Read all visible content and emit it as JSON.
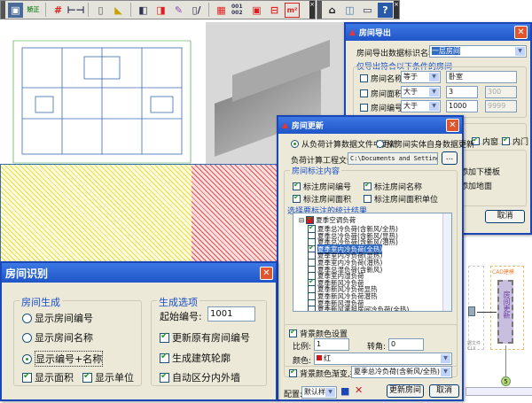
{
  "toolbar1": {
    "icons": [
      "room-recognize-icon",
      "correct-icon",
      "grid-icon",
      "dimension-icon",
      "wall-icon",
      "arc-area-icon",
      "door-icon",
      "door-dropdown-icon",
      "edit-icon",
      "window-edit-icon",
      "table-search-icon",
      "number-sort-icon",
      "room-frame-icon",
      "export-icon",
      "area-m2-icon"
    ],
    "correct_label": "矫正",
    "area_label": "m²",
    "sort_label": "001 002"
  },
  "toolbar2": {
    "icons": [
      "house-icon",
      "3d-box-icon",
      "room-query-icon",
      "help-icon"
    ],
    "help_label": "?"
  },
  "export_dialog": {
    "title": "房间导出",
    "name_label": "房间导出数据标识名称:",
    "name_value": "一层房间",
    "filter_label": "仅导出符合以下条件的房间",
    "rows": [
      {
        "label": "房间名称",
        "op": "等于",
        "value": "卧室",
        "value2": ""
      },
      {
        "label": "房间面积",
        "op": "大于",
        "value": "3",
        "value2": "300"
      },
      {
        "label": "房间编号",
        "op": "大于",
        "value": "1000",
        "value2": "9999"
      }
    ],
    "inner_window": "内窗",
    "inner_door": "内门",
    "add_floor_below": "动添加下楼板",
    "add_ground": "动添加地面",
    "cancel": "取消"
  },
  "update_dialog": {
    "title": "房间更新",
    "radio1": "从负荷计算数据文件中更新",
    "radio2": "从房间实体自身数据更新",
    "file_label": "负荷计算工程文件:",
    "file_value": "C:\\Documents and Settings\\Ch",
    "browse": "...",
    "annot_group": "房间标注内容",
    "annot": [
      {
        "label": "标注房间编号",
        "checked": true
      },
      {
        "label": "标注房间名称",
        "checked": true
      },
      {
        "label": "标注房间面积",
        "checked": true
      },
      {
        "label": "标注房间面积单位",
        "checked": false
      }
    ],
    "result_group": "选择要标注的统计结果",
    "tree_root": "夏季空调负荷",
    "tree_items": [
      {
        "label": "夏季总冷负荷(含新风/全热)",
        "checked": true
      },
      {
        "label": "夏季总冷负荷(含新风/显热)",
        "checked": false
      },
      {
        "label": "夏季总冷负荷(含新风/潜热)",
        "checked": false
      },
      {
        "label": "夏季室内冷负荷(全热)",
        "checked": true,
        "selected": true
      },
      {
        "label": "夏季室内冷负荷(显热)",
        "checked": false
      },
      {
        "label": "夏季室内冷负荷(潜热)",
        "checked": false
      },
      {
        "label": "夏季总湿负荷(含新风)",
        "checked": false
      },
      {
        "label": "夏季室内湿负荷",
        "checked": false
      },
      {
        "label": "夏季新风冷负荷",
        "checked": true
      },
      {
        "label": "夏季新风冷负荷显热",
        "checked": false
      },
      {
        "label": "夏季新风冷负荷潜热",
        "checked": false
      },
      {
        "label": "夏季新风湿负荷",
        "checked": false
      },
      {
        "label": "夏季新风承担房间冷负荷(全热)",
        "checked": false
      }
    ],
    "bg_label": "背景颜色设置",
    "scale_label": "比例:",
    "scale_value": "1",
    "angle_label": "转角:",
    "angle_value": "0",
    "color_label": "颜色:",
    "color_value": "红",
    "color_swatch": "#d01818",
    "gradient_label": "背景颜色渐变,按",
    "gradient_value": "夏季总冷负荷(含新风/全热)",
    "config_label": "配置:",
    "config_value": "默认样式",
    "update_btn": "更新房间",
    "cancel_btn": "取消"
  },
  "recog_dialog": {
    "title": "房间识别",
    "gen_group": "房间生成",
    "radios": [
      {
        "label": "显示房间编号",
        "selected": false
      },
      {
        "label": "显示房间名称",
        "selected": false
      },
      {
        "label": "显示编号+名称",
        "selected": true
      }
    ],
    "show_area": "显示面积",
    "show_unit": "显示单位",
    "opt_group": "生成选项",
    "start_label": "起始编号:",
    "start_value": "1001",
    "opts": [
      {
        "label": "更新原有房间编号",
        "checked": true
      },
      {
        "label": "生成建筑轮廓",
        "checked": true
      },
      {
        "label": "自动区分内外墙",
        "checked": true
      }
    ]
  },
  "diagram": {
    "cad_label": "CAD建模",
    "node_label": "房间更新",
    "file_label": "据文件 CLX",
    "step": "5"
  },
  "colors": {
    "title_bar": "#1f55c8",
    "dialog_bg": "#ece9d8",
    "hatch_yellow": "#e8e040",
    "hatch_red": "#e05050"
  }
}
